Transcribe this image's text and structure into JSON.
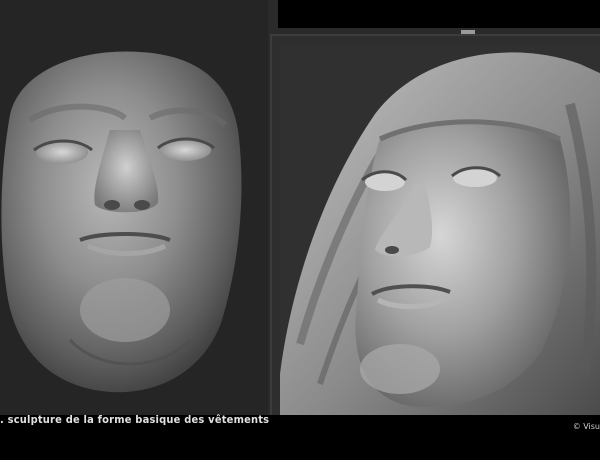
{
  "caption": ". sculpture de la forme basique des vêtements",
  "copyright": "© Visu",
  "colors": {
    "background": "#2a2a2a",
    "bars": "#000000",
    "caption_text": "#e2e2e2"
  },
  "images": {
    "left": "sculpted-face-mask",
    "right": "sculpted-head-with-veil"
  }
}
